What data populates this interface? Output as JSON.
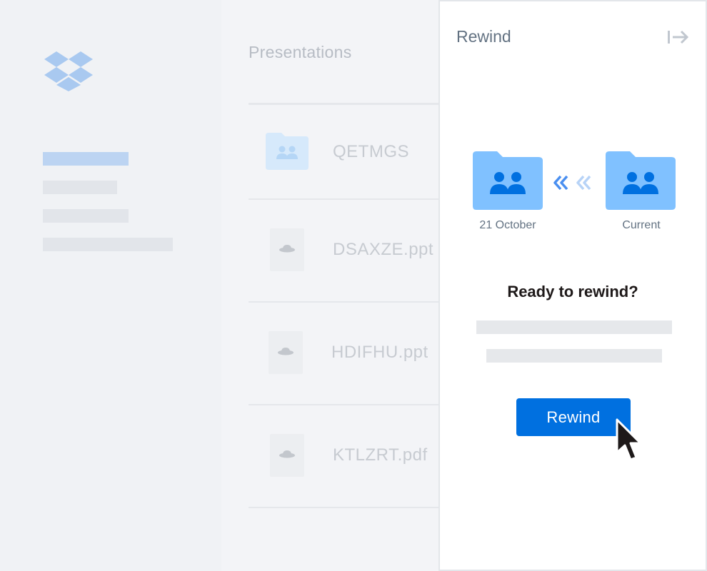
{
  "sidebar": {
    "nav_items": [
      {
        "state": "active"
      },
      {
        "state": "inactive"
      },
      {
        "state": "inactive"
      },
      {
        "state": "inactive"
      }
    ]
  },
  "main": {
    "folder_title": "Presentations",
    "rows": [
      {
        "name": "QETMGS",
        "type": "shared-folder"
      },
      {
        "name": "DSAXZE.ppt",
        "type": "file"
      },
      {
        "name": "HDIFHU.ppt",
        "type": "file"
      },
      {
        "name": "KTLZRT.pdf",
        "type": "file"
      }
    ]
  },
  "panel": {
    "title": "Rewind",
    "from_label": "21 October",
    "to_label": "Current",
    "heading": "Ready to rewind?",
    "button_label": "Rewind"
  },
  "colors": {
    "accent": "#0070e0",
    "folder": "#80c1ff",
    "folder_faded": "#d6e9fb"
  }
}
